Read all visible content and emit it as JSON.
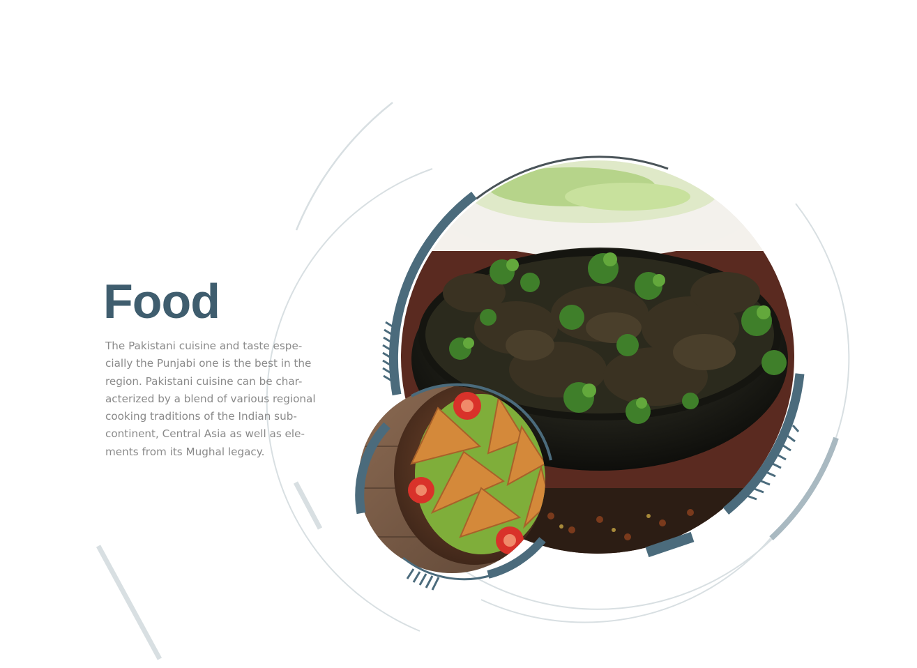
{
  "slide": {
    "title": "Food",
    "description_lines": [
      "The Pakistani cuisine and taste espe-",
      "cially the Punjabi one is the best in the",
      "region. Pakistani cuisine can be char-",
      "acterized by a blend of various regional",
      "cooking traditions of the Indian sub-",
      "continent, Central Asia as well as ele-",
      "ments from its Mughal legacy."
    ]
  },
  "colors": {
    "accent": "#4b6b7c",
    "accent_dark": "#3f5d6e",
    "ring_light": "#d8dfe2",
    "ring_mid": "#a9b9c1",
    "text_body": "#8a8a8a"
  },
  "images": [
    {
      "name": "curry-dish-photo",
      "content": "dark meat curry in an iron bowl topped with fresh coriander"
    },
    {
      "name": "samosa-plate-photo",
      "content": "fried samosas on lettuce with cherry tomatoes"
    }
  ]
}
